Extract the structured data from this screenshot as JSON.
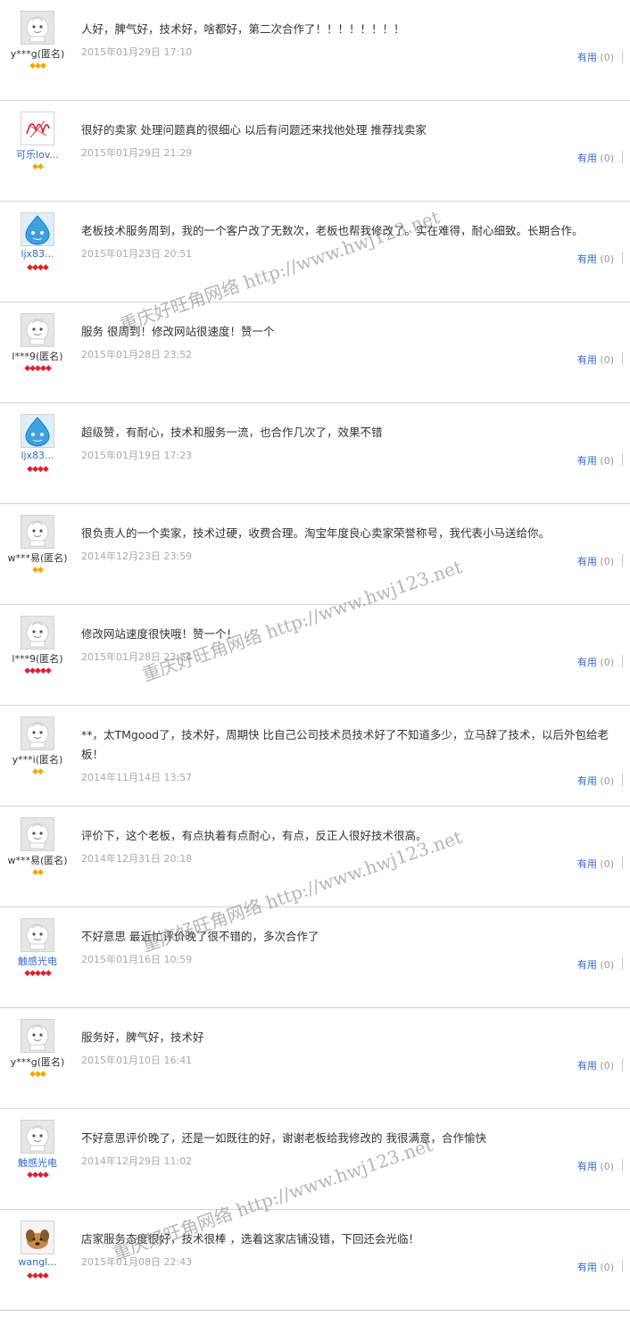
{
  "reviews": [
    {
      "user": "y***g(匿名)",
      "user_style": "anon",
      "rank": "◆◆◆",
      "rank_style": "gold",
      "avatar": "default",
      "content": "人好，脾气好，技术好，啥都好，第二次合作了！！！！！！！！",
      "date": "2015年01月29日 17:10",
      "useful_label": "有用",
      "useful_count": "(0)"
    },
    {
      "user": "可乐lov...",
      "user_style": "link",
      "rank": "◆◆",
      "rank_style": "gold",
      "avatar": "sign",
      "content": "很好的卖家 处理问题真的很细心 以后有问题还来找他处理 推荐找卖家",
      "date": "2015年01月29日 21:29",
      "useful_label": "有用",
      "useful_count": "(0)"
    },
    {
      "user": "ljx83...",
      "user_style": "link",
      "rank": "◆◆◆◆",
      "rank_style": "red",
      "avatar": "blue",
      "content": "老板技术服务周到，我的一个客户改了无数次，老板也帮我修改了。实在难得，耐心细致。长期合作。",
      "date": "2015年01月23日 20:51",
      "useful_label": "有用",
      "useful_count": "(0)"
    },
    {
      "user": "l***9(匿名)",
      "user_style": "anon",
      "rank": "◆◆◆◆◆",
      "rank_style": "red",
      "avatar": "default",
      "content": "服务 很周到！修改网站很速度！赞一个",
      "date": "2015年01月28日 23:52",
      "useful_label": "有用",
      "useful_count": "(0)"
    },
    {
      "user": "ljx83...",
      "user_style": "link",
      "rank": "◆◆◆◆",
      "rank_style": "red",
      "avatar": "blue",
      "content": "超级赞，有耐心，技术和服务一流，也合作几次了，效果不错",
      "date": "2015年01月19日 17:23",
      "useful_label": "有用",
      "useful_count": "(0)"
    },
    {
      "user": "w***易(匿名)",
      "user_style": "anon",
      "rank": "◆◆",
      "rank_style": "gold",
      "avatar": "default",
      "content": "很负责人的一个卖家，技术过硬，收费合理。淘宝年度良心卖家荣誉称号，我代表小马送给你。",
      "date": "2014年12月23日 23:59",
      "useful_label": "有用",
      "useful_count": "(0)"
    },
    {
      "user": "l***9(匿名)",
      "user_style": "anon",
      "rank": "◆◆◆◆◆",
      "rank_style": "red",
      "avatar": "default",
      "content": "修改网站速度很快哦！赞一个！",
      "date": "2015年01月28日 23:54",
      "useful_label": "有用",
      "useful_count": "(0)"
    },
    {
      "user": "y***i(匿名)",
      "user_style": "anon",
      "rank": "◆◆",
      "rank_style": "gold",
      "avatar": "default",
      "content": "**，太TMgood了，技术好，周期快 比自己公司技术员技术好了不知道多少，立马辞了技术，以后外包给老板！",
      "date": "2014年11月14日 13:57",
      "useful_label": "有用",
      "useful_count": "(0)"
    },
    {
      "user": "w***易(匿名)",
      "user_style": "anon",
      "rank": "◆◆",
      "rank_style": "gold",
      "avatar": "default",
      "content": "评价下，这个老板，有点执着有点耐心，有点，反正人很好技术很高。",
      "date": "2014年12月31日 20:18",
      "useful_label": "有用",
      "useful_count": "(0)"
    },
    {
      "user": "触感光电",
      "user_style": "link",
      "rank": "◆◆◆◆◆",
      "rank_style": "red",
      "avatar": "default",
      "content": "不好意思 最近忙评价晚了很不错的，多次合作了",
      "date": "2015年01月16日 10:59",
      "useful_label": "有用",
      "useful_count": "(0)"
    },
    {
      "user": "y***g(匿名)",
      "user_style": "anon",
      "rank": "◆◆◆",
      "rank_style": "gold",
      "avatar": "default",
      "content": "服务好，脾气好，技术好",
      "date": "2015年01月10日 16:41",
      "useful_label": "有用",
      "useful_count": "(0)"
    },
    {
      "user": "触感光电",
      "user_style": "link",
      "rank": "◆◆◆◆",
      "rank_style": "red",
      "avatar": "default",
      "content": "不好意思评价晚了，还是一如既往的好，谢谢老板给我修改的 我很满意，合作愉快",
      "date": "2014年12月29日 11:02",
      "useful_label": "有用",
      "useful_count": "(0)"
    },
    {
      "user": "wangl...",
      "user_style": "link",
      "rank": "◆◆◆◆",
      "rank_style": "red",
      "avatar": "dog",
      "content": "店家服务态度很好，技术很棒 ，选着这家店铺没错，下回还会光临！",
      "date": "2015年01月08日 22:43",
      "useful_label": "有用",
      "useful_count": "(0)"
    }
  ],
  "watermark": {
    "text": "重庆好旺角网络 http://www.hwj123.net"
  }
}
